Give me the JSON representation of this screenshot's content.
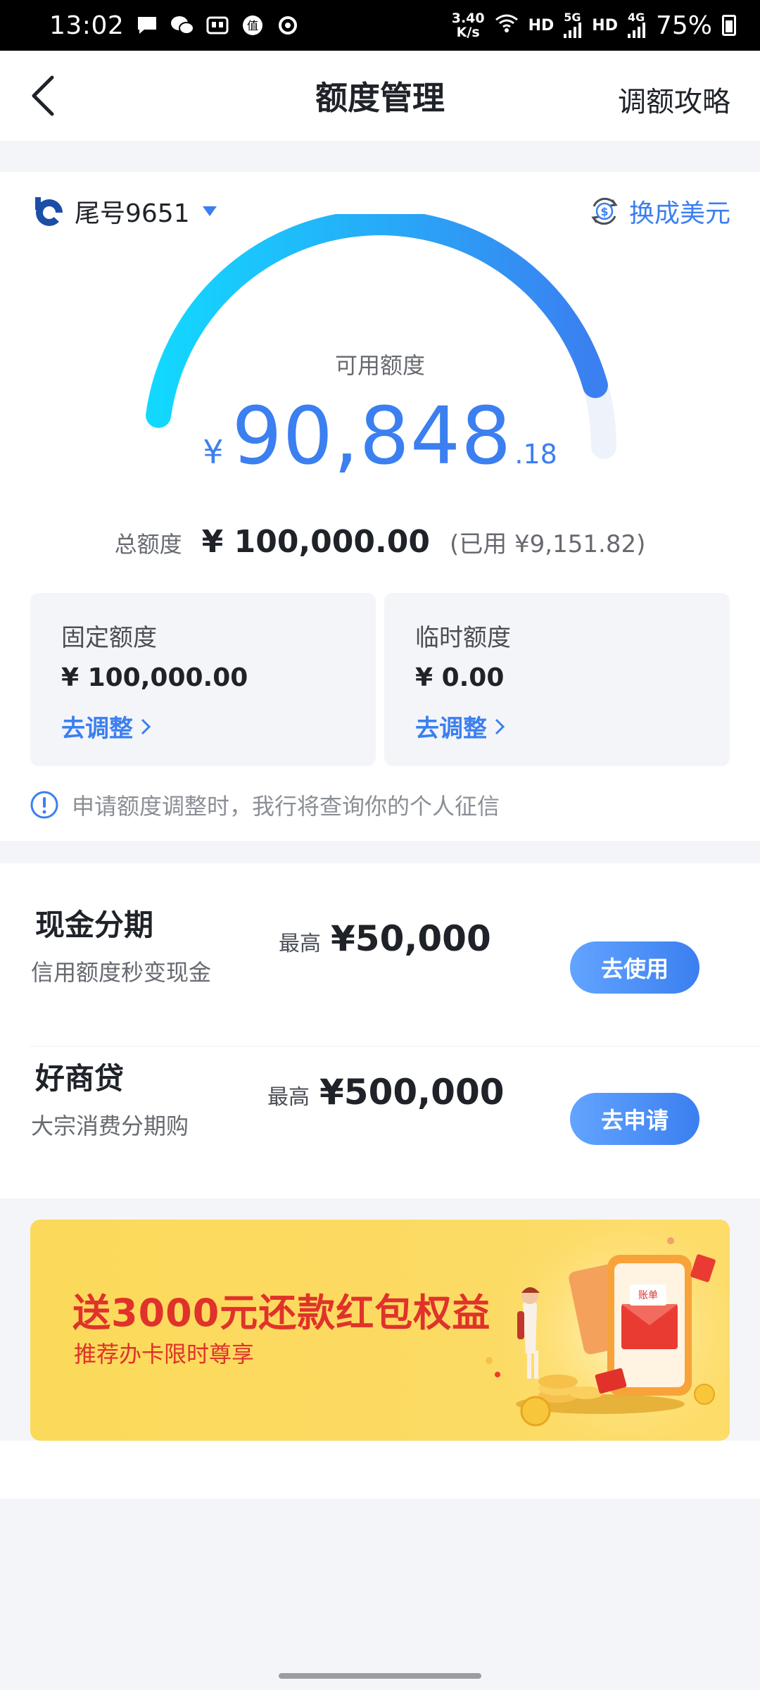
{
  "status_bar": {
    "time": "13:02",
    "speed_value": "3.40",
    "speed_unit": "K/s",
    "hd1": "HD",
    "net1": "5G",
    "hd2": "HD",
    "net2": "4G",
    "battery": "75%"
  },
  "header": {
    "title": "额度管理",
    "right_link": "调额攻略"
  },
  "account": {
    "label": "尾号9651",
    "currency_switch": "换成美元"
  },
  "gauge": {
    "label": "可用额度",
    "currency_symbol": "¥",
    "amount_int": "90,848",
    "amount_dec": ".18",
    "fill_fraction": 0.908
  },
  "totals": {
    "label": "总额度",
    "value": "¥ 100,000.00",
    "used": "(已用 ¥9,151.82)"
  },
  "boxes": [
    {
      "title": "固定额度",
      "value": "¥ 100,000.00",
      "link": "去调整"
    },
    {
      "title": "临时额度",
      "value": "¥ 0.00",
      "link": "去调整"
    }
  ],
  "notice": "申请额度调整时，我行将查询你的个人征信",
  "products": [
    {
      "name": "现金分期",
      "sub": "信用额度秒变现金",
      "max_label": "最高",
      "max_value": "¥50,000",
      "button": "去使用"
    },
    {
      "name": "好商贷",
      "sub": "大宗消费分期购",
      "max_label": "最高",
      "max_value": "¥500,000",
      "button": "去申请"
    }
  ],
  "banner": {
    "title": "送3000元还款红包权益",
    "subtitle": "推荐办卡限时尊享",
    "card_text": "账单"
  },
  "colors": {
    "accent": "#3b7ff0",
    "gauge_start": "#12d8ff",
    "gauge_end": "#3b7ff0",
    "gauge_track": "#eef2fb",
    "banner_red": "#e0322b",
    "banner_yellow": "#fbd95a"
  }
}
